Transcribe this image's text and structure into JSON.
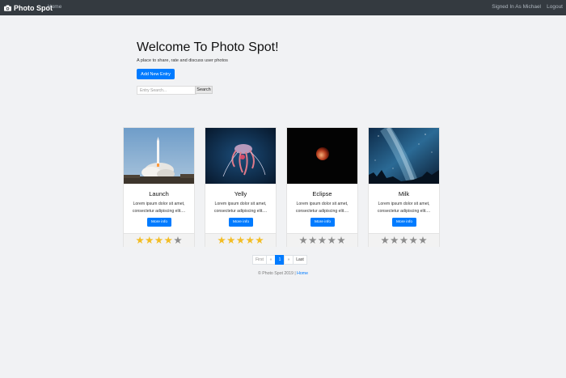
{
  "navbar": {
    "brand": "Photo Spot",
    "home": "Home",
    "signed_in": "Signed In As Michael",
    "logout": "Logout",
    "brand_icon": "camera-icon"
  },
  "hero": {
    "title": "Welcome To Photo Spot!",
    "subtitle": "A place to share, rate and discuss user photos",
    "add_button": "Add New Entry",
    "search_placeholder": "Entry Search...",
    "search_button": "Search"
  },
  "cards": [
    {
      "title": "Launch",
      "text": "Lorem ipsum dolor sit amet, consectetur adipiscing elit....",
      "button": "More info",
      "rating": 4
    },
    {
      "title": "Yelly",
      "text": "Lorem ipsum dolor sit amet, consectetur adipiscing elit....",
      "button": "More info",
      "rating": 5
    },
    {
      "title": "Eclipse",
      "text": "Lorem ipsum dolor sit amet, consectetur adipiscing elit....",
      "button": "More info",
      "rating": 0
    },
    {
      "title": "Milk",
      "text": "Lorem ipsum dolor sit amet, consectetur adipiscing elit....",
      "button": "More info",
      "rating": 0
    }
  ],
  "rating_max": 5,
  "pagination": {
    "first": "First",
    "prev": "«",
    "current": "1",
    "next": "»",
    "last": "Last"
  },
  "footer": {
    "text": "© Photo Spot 2019 |",
    "link": "Home"
  },
  "colors": {
    "navbar": "#343a40",
    "primary": "#007bff",
    "star_on": "#f3bd24",
    "star_off": "#8d8d8d"
  }
}
